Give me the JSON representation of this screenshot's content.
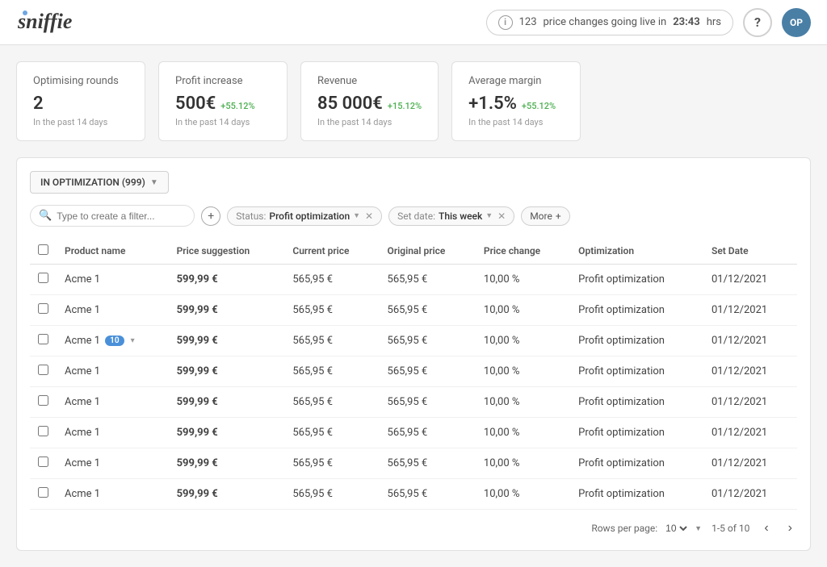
{
  "header": {
    "logo": "sniffie",
    "alert": {
      "count": "123",
      "message": "price changes going live in",
      "timer": "23:43",
      "unit": "hrs"
    },
    "help_label": "?",
    "avatar_initials": "OP"
  },
  "stats": [
    {
      "title": "Optimising rounds",
      "value": "2",
      "badge": "",
      "sub": "In the past 14 days"
    },
    {
      "title": "Profit increase",
      "value": "500€",
      "badge": "+55.12%",
      "sub": "In the past 14 days"
    },
    {
      "title": "Revenue",
      "value": "85 000€",
      "badge": "+15.12%",
      "sub": "In the past 14 days"
    },
    {
      "title": "Average margin",
      "value": "+1.5%",
      "badge": "+55.12%",
      "sub": "In the past 14 days"
    }
  ],
  "selector": {
    "label": "IN OPTIMIZATION (999)"
  },
  "filters": {
    "search_placeholder": "Type to create a filter...",
    "chips": [
      {
        "label": "Status:",
        "value": "Profit optimization"
      },
      {
        "label": "Set date:",
        "value": "This week"
      }
    ],
    "more_label": "More"
  },
  "table": {
    "columns": [
      "Product name",
      "Price suggestion",
      "Current price",
      "Original price",
      "Price change",
      "Optimization",
      "Set Date"
    ],
    "rows": [
      {
        "product": "Acme 1",
        "badge": null,
        "price_suggestion": "599,99 €",
        "current_price": "565,95 €",
        "original_price": "565,95 €",
        "price_change": "10,00 %",
        "optimization": "Profit optimization",
        "set_date": "01/12/2021"
      },
      {
        "product": "Acme 1",
        "badge": null,
        "price_suggestion": "599,99 €",
        "current_price": "565,95 €",
        "original_price": "565,95 €",
        "price_change": "10,00 %",
        "optimization": "Profit optimization",
        "set_date": "01/12/2021"
      },
      {
        "product": "Acme 1",
        "badge": "10",
        "price_suggestion": "599,99 €",
        "current_price": "565,95 €",
        "original_price": "565,95 €",
        "price_change": "10,00 %",
        "optimization": "Profit optimization",
        "set_date": "01/12/2021"
      },
      {
        "product": "Acme 1",
        "badge": null,
        "price_suggestion": "599,99 €",
        "current_price": "565,95 €",
        "original_price": "565,95 €",
        "price_change": "10,00 %",
        "optimization": "Profit optimization",
        "set_date": "01/12/2021"
      },
      {
        "product": "Acme 1",
        "badge": null,
        "price_suggestion": "599,99 €",
        "current_price": "565,95 €",
        "original_price": "565,95 €",
        "price_change": "10,00 %",
        "optimization": "Profit optimization",
        "set_date": "01/12/2021"
      },
      {
        "product": "Acme 1",
        "badge": null,
        "price_suggestion": "599,99 €",
        "current_price": "565,95 €",
        "original_price": "565,95 €",
        "price_change": "10,00 %",
        "optimization": "Profit optimization",
        "set_date": "01/12/2021"
      },
      {
        "product": "Acme 1",
        "badge": null,
        "price_suggestion": "599,99 €",
        "current_price": "565,95 €",
        "original_price": "565,95 €",
        "price_change": "10,00 %",
        "optimization": "Profit optimization",
        "set_date": "01/12/2021"
      },
      {
        "product": "Acme 1",
        "badge": null,
        "price_suggestion": "599,99 €",
        "current_price": "565,95 €",
        "original_price": "565,95 €",
        "price_change": "10,00 %",
        "optimization": "Profit optimization",
        "set_date": "01/12/2021"
      }
    ]
  },
  "pagination": {
    "rows_per_page_label": "Rows per page:",
    "rows_per_page_value": "10",
    "page_info": "1-5 of 10"
  }
}
